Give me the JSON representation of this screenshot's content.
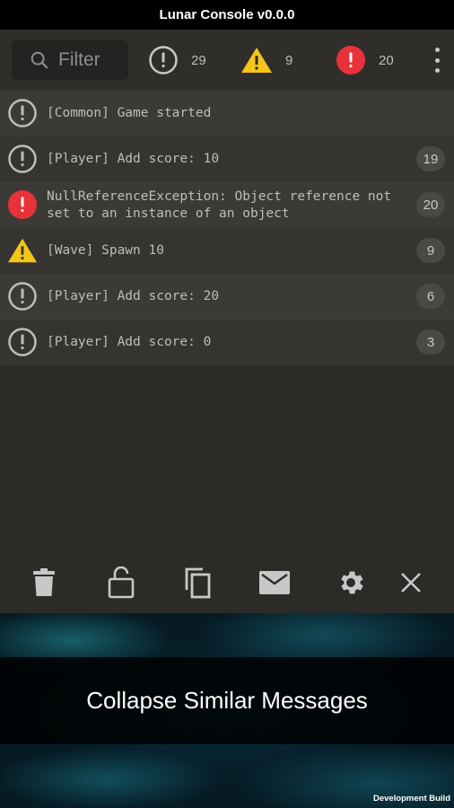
{
  "window": {
    "title": "Lunar Console v0.0.0"
  },
  "toolbar": {
    "filter_placeholder": "Filter",
    "counters": {
      "log": "29",
      "warning": "9",
      "error": "20"
    }
  },
  "log": [
    {
      "type": "log",
      "text": "[Common] Game started",
      "count": ""
    },
    {
      "type": "log",
      "text": "[Player] Add score: 10",
      "count": "19"
    },
    {
      "type": "error",
      "text": "NullReferenceException: Object reference not set to an instance of an object",
      "count": "20"
    },
    {
      "type": "warning",
      "text": "[Wave] Spawn 10",
      "count": "9"
    },
    {
      "type": "log",
      "text": "[Player] Add score: 20",
      "count": "6"
    },
    {
      "type": "log",
      "text": "[Player] Add score: 0",
      "count": "3"
    }
  ],
  "actions": [
    "trash-icon",
    "lock-open-icon",
    "copy-icon",
    "mail-icon",
    "gear-icon",
    "close-icon"
  ],
  "banner": {
    "text": "Collapse Similar Messages"
  },
  "footer": {
    "dev_build": "Development Build"
  },
  "colors": {
    "error": "#e8323a",
    "warning": "#f5c518",
    "log_icon": "#bdbdbd",
    "background": "#2c2b28"
  }
}
